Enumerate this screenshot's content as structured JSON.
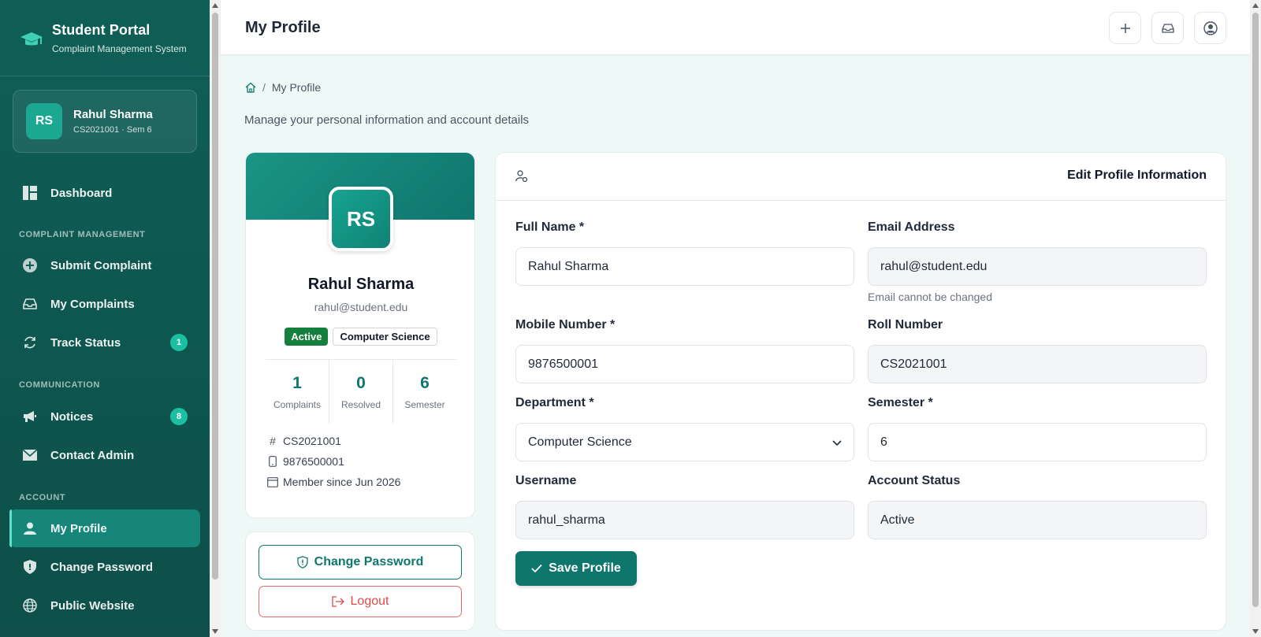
{
  "brand": {
    "title": "Student Portal",
    "subtitle": "Complaint Management System"
  },
  "user": {
    "initials": "RS",
    "name": "Rahul Sharma",
    "meta": "CS2021001 · Sem 6"
  },
  "sidebar": {
    "dashboard": "Dashboard",
    "section_complaints": "COMPLAINT MANAGEMENT",
    "submit": "Submit Complaint",
    "my_complaints": "My Complaints",
    "track": "Track Status",
    "track_badge": "1",
    "section_comm": "COMMUNICATION",
    "notices": "Notices",
    "notices_badge": "8",
    "contact": "Contact Admin",
    "section_account": "ACCOUNT",
    "profile": "My Profile",
    "change_password": "Change Password",
    "public_website": "Public Website"
  },
  "header": {
    "title": "My Profile"
  },
  "breadcrumb": {
    "current": "My Profile",
    "sep": "/"
  },
  "subtitle": "Manage your personal information and account details",
  "profile": {
    "initials": "RS",
    "name": "Rahul Sharma",
    "email": "rahul@student.edu",
    "status_tag": "Active",
    "dept_tag": "Computer Science",
    "stats": [
      {
        "value": "1",
        "label": "Complaints"
      },
      {
        "value": "0",
        "label": "Resolved"
      },
      {
        "value": "6",
        "label": "Semester"
      }
    ],
    "roll_hash": "#",
    "roll": "CS2021001",
    "phone": "9876500001",
    "member_since": "Member since Jun 2026"
  },
  "actions": {
    "change_password": "Change Password",
    "logout": "Logout"
  },
  "form": {
    "title": "Edit Profile Information",
    "full_name_label": "Full Name *",
    "full_name": "Rahul Sharma",
    "email_label": "Email Address",
    "email": "rahul@student.edu",
    "email_help": "Email cannot be changed",
    "mobile_label": "Mobile Number *",
    "mobile": "9876500001",
    "roll_label": "Roll Number",
    "roll": "CS2021001",
    "department_label": "Department *",
    "department": "Computer Science",
    "semester_label": "Semester *",
    "semester": "6",
    "username_label": "Username",
    "username": "rahul_sharma",
    "status_label": "Account Status",
    "status": "Active",
    "save": "Save Profile"
  },
  "colors": {
    "sidebar": "#0f5f57",
    "accent": "#0f766e",
    "badge": "#1dbfa3",
    "danger": "#dc4b4b"
  }
}
